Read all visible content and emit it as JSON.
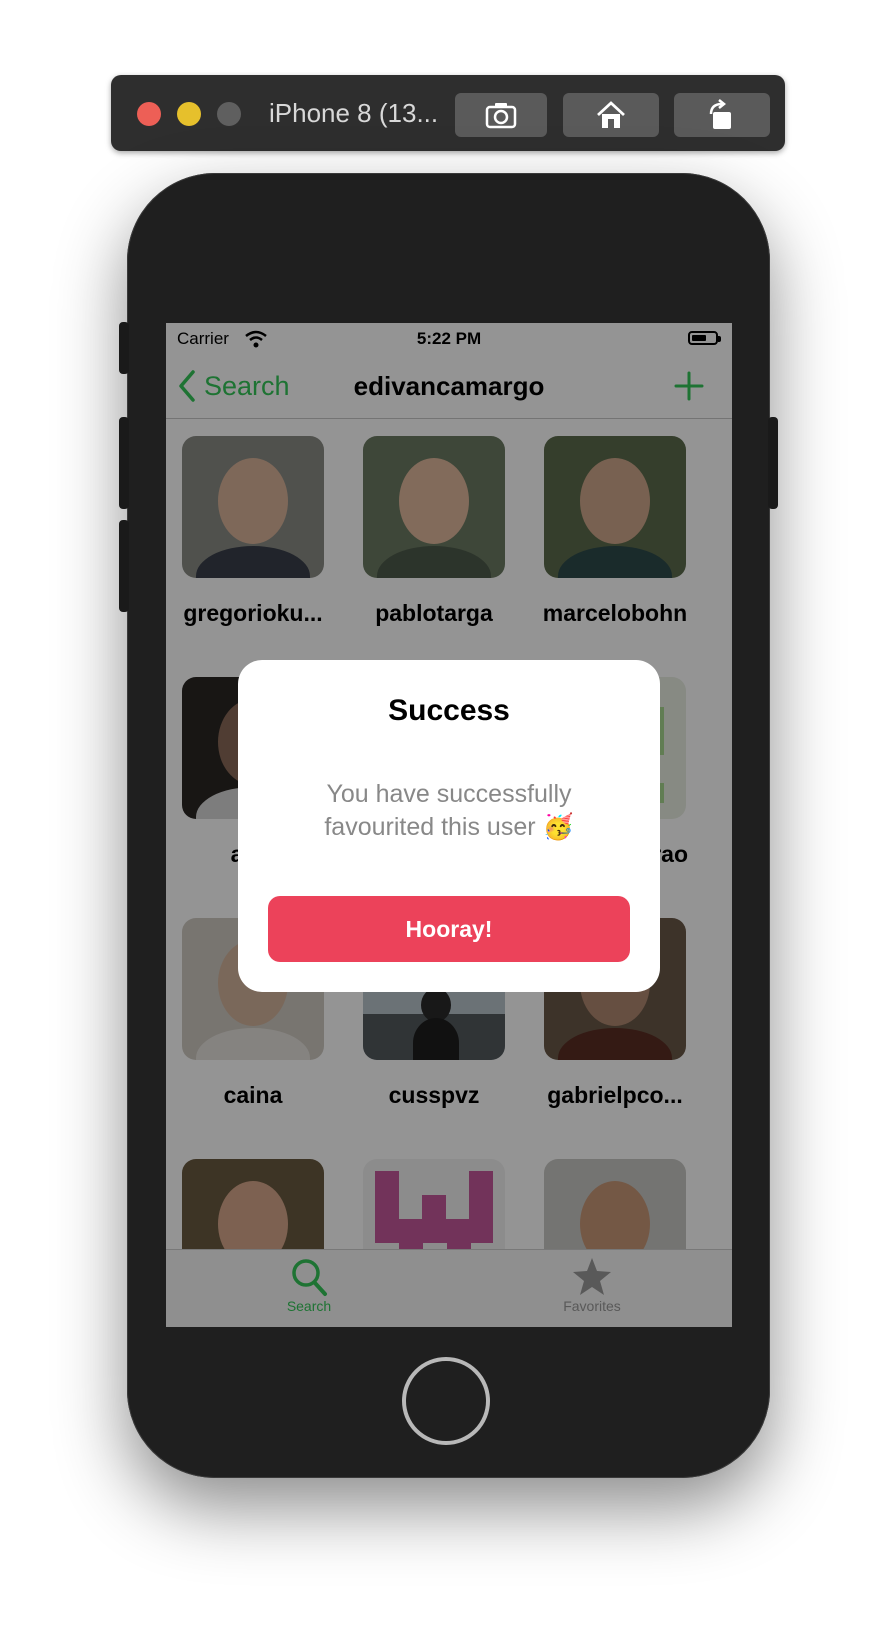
{
  "simulator": {
    "title": "iPhone 8 (13...",
    "buttons": {
      "screenshot_icon": "camera-icon",
      "home_icon": "home-icon",
      "rotate_icon": "rotate-icon"
    }
  },
  "statusbar": {
    "carrier": "Carrier",
    "time": "5:22 PM"
  },
  "navbar": {
    "back_label": "Search",
    "title": "edivancamargo",
    "add_icon": "plus-icon"
  },
  "users": [
    {
      "name": "gregorioku..."
    },
    {
      "name": "pablotarga"
    },
    {
      "name": "marcelobohn"
    },
    {
      "name": "alve"
    },
    {
      "name": ""
    },
    {
      "name": "rao"
    },
    {
      "name": "caina"
    },
    {
      "name": "cusspvz"
    },
    {
      "name": "gabrielpco..."
    },
    {
      "name": ""
    },
    {
      "name": ""
    },
    {
      "name": ""
    }
  ],
  "tabbar": {
    "items": [
      {
        "label": "Search",
        "icon": "search-icon"
      },
      {
        "label": "Favorites",
        "icon": "star-icon"
      }
    ]
  },
  "alert": {
    "title": "Success",
    "message": "You have successfully favourited this user 🥳",
    "button_label": "Hooray!"
  },
  "colors": {
    "accent": "#34c759",
    "alert_button": "#ec425a"
  }
}
